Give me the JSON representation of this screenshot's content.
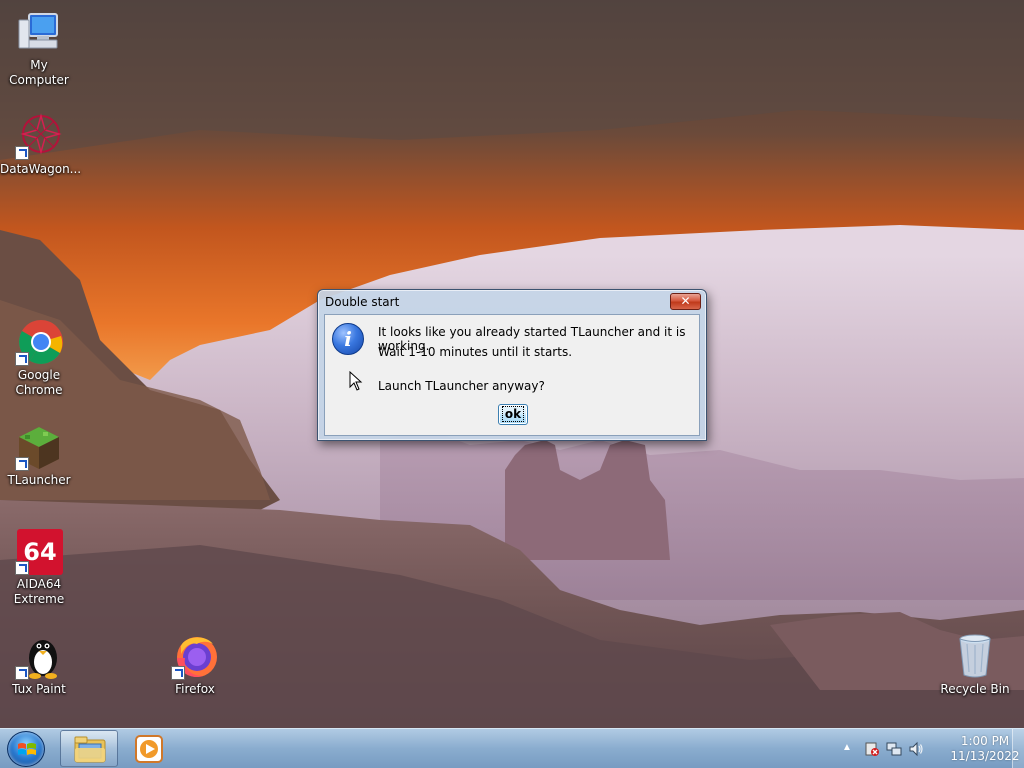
{
  "desktop": {
    "icons": [
      {
        "label": "My Computer"
      },
      {
        "label": "DataWagon..."
      },
      {
        "label": "Google Chrome"
      },
      {
        "label": "TLauncher"
      },
      {
        "label": "AIDA64 Extreme"
      },
      {
        "label": "Tux Paint"
      },
      {
        "label": "Firefox"
      },
      {
        "label": "Recycle Bin"
      }
    ]
  },
  "dialog": {
    "title": "Double start",
    "close_label": "✕",
    "icon": "information-icon",
    "message_line1": "It looks like you already started TLauncher and it is working.",
    "message_line2": "Wait 1-10 minutes until it starts.",
    "question": "Launch TLauncher anyway?",
    "ok_label": "ok"
  },
  "taskbar": {
    "pinned": [
      "windows-explorer-icon",
      "media-player-icon"
    ],
    "tray_icons": [
      "show-hidden-icons-icon",
      "action-center-icon",
      "network-icon",
      "volume-icon"
    ],
    "time": "1:00 PM",
    "date": "11/13/2022"
  }
}
